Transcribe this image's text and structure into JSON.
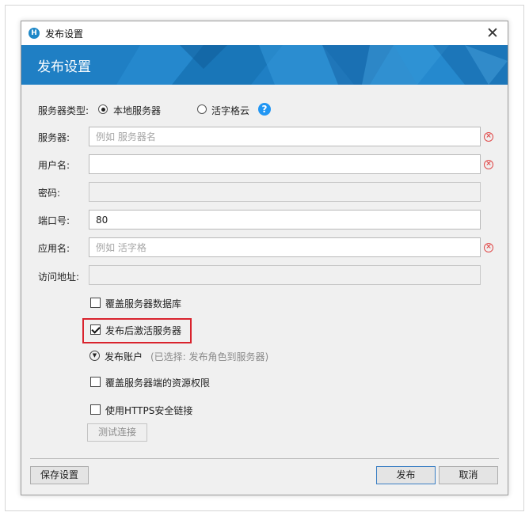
{
  "window": {
    "title": "发布设置",
    "app_icon_letter": "H"
  },
  "banner": {
    "title": "发布设置"
  },
  "server_type": {
    "label": "服务器类型:",
    "options": [
      {
        "label": "本地服务器",
        "selected": true
      },
      {
        "label": "活字格云",
        "selected": false
      }
    ],
    "help": "?"
  },
  "fields": {
    "server": {
      "label": "服务器:",
      "value": "",
      "placeholder": "例如 服务器名",
      "required": true
    },
    "username": {
      "label": "用户名:",
      "value": "",
      "placeholder": "",
      "required": true
    },
    "password": {
      "label": "密码:",
      "value": "",
      "disabled": true
    },
    "port": {
      "label": "端口号:",
      "value": "80"
    },
    "appname": {
      "label": "应用名:",
      "value": "",
      "placeholder": "例如 活字格",
      "required": true
    },
    "address": {
      "label": "访问地址:",
      "value": "",
      "disabled": true
    }
  },
  "options": {
    "overwrite_db": {
      "label": "覆盖服务器数据库",
      "checked": false
    },
    "activate_after_publish": {
      "label": "发布后激活服务器",
      "checked": true
    },
    "publish_account": {
      "label": "发布账户",
      "hint": "(已选择: 发布角色到服务器)"
    },
    "overwrite_permissions": {
      "label": "覆盖服务器端的资源权限",
      "checked": false
    },
    "use_https": {
      "label": "使用HTTPS安全链接",
      "checked": false
    }
  },
  "buttons": {
    "test_connection": "测试连接",
    "save_settings": "保存设置",
    "publish": "发布",
    "cancel": "取消"
  },
  "colors": {
    "banner": "#1f7fc4",
    "highlight": "#d9232d",
    "error": "#e04a4a",
    "help": "#2196f3"
  }
}
